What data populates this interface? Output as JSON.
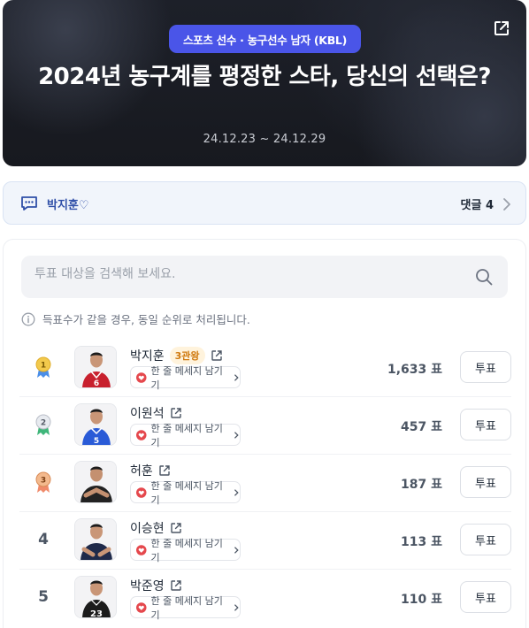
{
  "hero": {
    "category": "스포츠 선수 · 농구선수 남자 (KBL)",
    "title": "2024년 농구계를 평정한 스타, 당신의 선택은?",
    "date_range": "24.12.23 ~ 24.12.29"
  },
  "comment_bar": {
    "user": "박지훈♡",
    "count_label": "댓글 4"
  },
  "search": {
    "placeholder": "투표 대상을 검색해 보세요."
  },
  "notice": "득표수가 같을 경우, 동일 순위로 처리됩니다.",
  "message_label": "한 줄 메세지 남기기",
  "vote_label": "투표",
  "candidates": [
    {
      "rank": "1",
      "name": "박지훈",
      "badge": "3관왕",
      "votes": "1,633 표",
      "jersey": "6",
      "uniform": "#c8202e"
    },
    {
      "rank": "2",
      "name": "이원석",
      "badge": "",
      "votes": "457 표",
      "jersey": "5",
      "uniform": "#2a5bd7"
    },
    {
      "rank": "3",
      "name": "허훈",
      "badge": "",
      "votes": "187 표",
      "jersey": "",
      "uniform": "#222222"
    },
    {
      "rank": "4",
      "name": "이승현",
      "badge": "",
      "votes": "113 표",
      "jersey": "",
      "uniform": "#1f2a4a"
    },
    {
      "rank": "5",
      "name": "박준영",
      "badge": "",
      "votes": "110 표",
      "jersey": "23",
      "uniform": "#1c1c1c"
    }
  ],
  "colors": {
    "accent": "#4a55e8",
    "gold": "#f2c94c",
    "silver": "#cfd3da",
    "bronze": "#e49a6a"
  }
}
